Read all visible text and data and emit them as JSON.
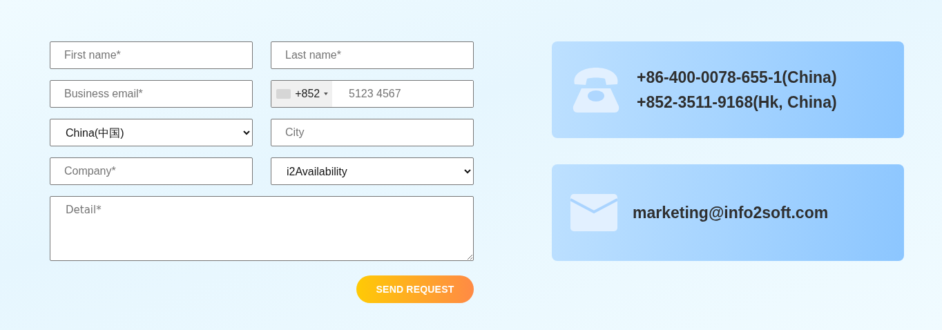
{
  "form": {
    "fields": [
      {
        "kind": "text",
        "placeholder": "First name*"
      },
      {
        "kind": "text",
        "placeholder": "Last name*"
      },
      {
        "kind": "text",
        "placeholder": "Business email*"
      },
      {
        "kind": "phone",
        "code": "+852",
        "placeholder": "5123 4567"
      },
      {
        "kind": "select",
        "value": "China(中国)"
      },
      {
        "kind": "text",
        "placeholder": "City"
      },
      {
        "kind": "text",
        "placeholder": "Company*"
      },
      {
        "kind": "select",
        "value": "i2Availability"
      }
    ],
    "detail": {
      "placeholder": "Detail*"
    },
    "submit": "SEND REQUEST"
  },
  "contacts": [
    {
      "kind": "phone",
      "lines": [
        "+86-400-0078-655-1(China)",
        "+852-3511-9168(Hk, China)"
      ]
    },
    {
      "kind": "email",
      "lines": [
        "marketing@info2soft.com"
      ]
    }
  ]
}
